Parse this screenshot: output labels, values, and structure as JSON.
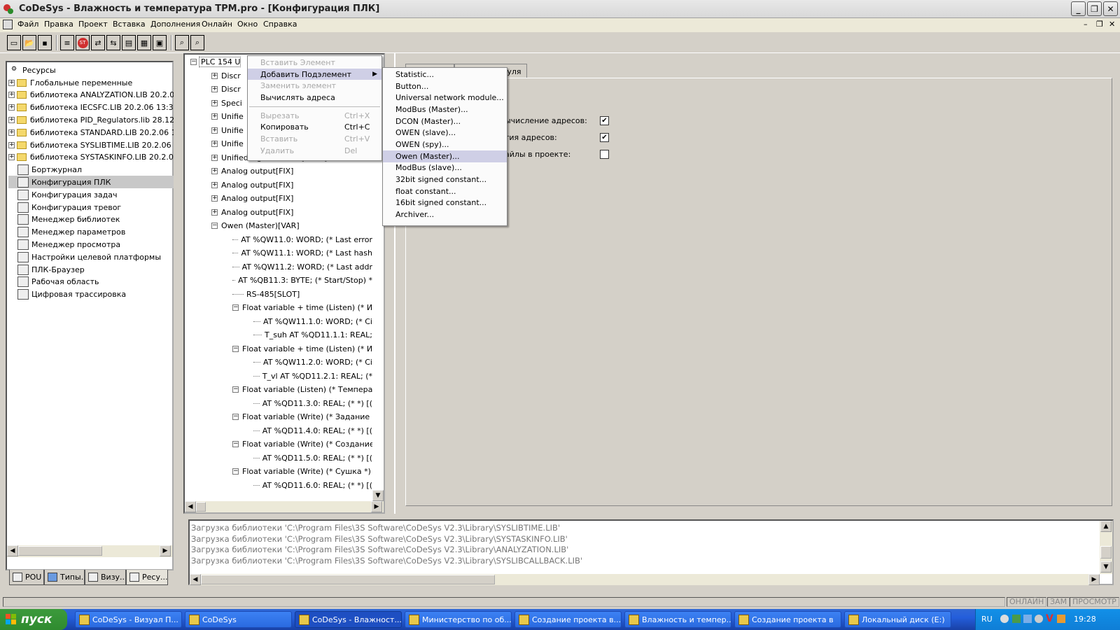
{
  "window": {
    "title": "CoDeSys - Влажность и температура ТРМ.pro - [Конфигурация ПЛК]",
    "app_icon": "codesys-app-icon",
    "controls": [
      "minimize",
      "restore",
      "close"
    ]
  },
  "menubar": {
    "items": [
      "Файл",
      "Правка",
      "Проект",
      "Вставка",
      "Дополнения",
      "Онлайн",
      "Окно",
      "Справка"
    ]
  },
  "toolbar": {
    "buttons": [
      "new-icon",
      "open-icon",
      "save-icon",
      "build-icon",
      "stop-icon",
      "login-icon",
      "logout-icon",
      "step-icon",
      "watch-icon",
      "print-icon",
      "find-icon",
      "replace-icon"
    ],
    "labels": {
      "stop": "ST"
    }
  },
  "resources": {
    "root": "Ресурсы",
    "items": [
      {
        "label": "Глобальные переменные",
        "type": "folder",
        "expandable": true
      },
      {
        "label": "библиотека ANALYZATION.LIB 20.2.06",
        "type": "folder",
        "expandable": true
      },
      {
        "label": "библиотека IECSFC.LIB 20.2.06 13:31:0",
        "type": "folder",
        "expandable": true
      },
      {
        "label": "библиотека PID_Regulators.lib 28.12.06",
        "type": "folder",
        "expandable": true
      },
      {
        "label": "библиотека STANDARD.LIB 20.2.06 13",
        "type": "folder",
        "expandable": true
      },
      {
        "label": "библиотека SYSLIBTIME.LIB 20.2.06 1",
        "type": "folder",
        "expandable": true
      },
      {
        "label": "библиотека SYSTASKINFO.LIB 20.2.06",
        "type": "folder",
        "expandable": true
      },
      {
        "label": "Бортжурнал",
        "type": "logbook-icon"
      },
      {
        "label": "Конфигурация ПЛК",
        "type": "plc-config-icon",
        "selected": true
      },
      {
        "label": "Конфигурация задач",
        "type": "task-config-icon"
      },
      {
        "label": "Конфигурация тревог",
        "type": "alarm-config-icon"
      },
      {
        "label": "Менеджер библиотек",
        "type": "library-manager-icon"
      },
      {
        "label": "Менеджер параметров",
        "type": "parameter-manager-icon"
      },
      {
        "label": "Менеджер просмотра",
        "type": "watch-manager-icon"
      },
      {
        "label": "Настройки целевой платформы",
        "type": "target-settings-icon"
      },
      {
        "label": "ПЛК-Браузер",
        "type": "plc-browser-icon"
      },
      {
        "label": "Рабочая область",
        "type": "workspace-icon"
      },
      {
        "label": "Цифровая трассировка",
        "type": "trace-icon"
      }
    ]
  },
  "left_tabs": [
    {
      "label": "POU",
      "icon": "pou-icon"
    },
    {
      "label": "Типы...",
      "icon": "types-icon"
    },
    {
      "label": "Визу...",
      "icon": "visualization-icon"
    },
    {
      "label": "Ресу...",
      "icon": "resources-icon"
    }
  ],
  "plc_tree": {
    "rows": [
      {
        "indent": 0,
        "toggle": "−",
        "text": "PLC 154 U"
      },
      {
        "indent": 1,
        "toggle": "+",
        "text": "Discr"
      },
      {
        "indent": 1,
        "toggle": "+",
        "text": "Discr"
      },
      {
        "indent": 1,
        "toggle": "+",
        "text": "Speci"
      },
      {
        "indent": 1,
        "toggle": "+",
        "text": "Unifie"
      },
      {
        "indent": 1,
        "toggle": "+",
        "text": "Unifie"
      },
      {
        "indent": 1,
        "toggle": "+",
        "text": "Unifie"
      },
      {
        "indent": 1,
        "toggle": "+",
        "text": "Unified signal sensor[SLOT]"
      },
      {
        "indent": 1,
        "toggle": "+",
        "text": "Analog output[FIX]"
      },
      {
        "indent": 1,
        "toggle": "+",
        "text": "Analog output[FIX]"
      },
      {
        "indent": 1,
        "toggle": "+",
        "text": "Analog output[FIX]"
      },
      {
        "indent": 1,
        "toggle": "+",
        "text": "Analog output[FIX]"
      },
      {
        "indent": 1,
        "toggle": "−",
        "text": "Owen (Master)[VAR]"
      },
      {
        "indent": 2,
        "toggle": "",
        "text": "AT %QW11.0: WORD; (* Last error"
      },
      {
        "indent": 2,
        "toggle": "",
        "text": "AT %QW11.1: WORD; (* Last hash"
      },
      {
        "indent": 2,
        "toggle": "",
        "text": "AT %QW11.2: WORD; (* Last addr"
      },
      {
        "indent": 2,
        "toggle": "",
        "text": "AT %QB11.3: BYTE; (* Start/Stop) *"
      },
      {
        "indent": 2,
        "toggle": "",
        "text": "RS-485[SLOT]"
      },
      {
        "indent": 2,
        "toggle": "−",
        "text": "Float variable + time (Listen) (* Изм"
      },
      {
        "indent": 3,
        "toggle": "",
        "text": "AT %QW11.1.0: WORD; (* Ci"
      },
      {
        "indent": 3,
        "toggle": "",
        "text": "T_suh AT %QD11.1.1: REAL;"
      },
      {
        "indent": 2,
        "toggle": "−",
        "text": "Float variable + time (Listen) (* Изм"
      },
      {
        "indent": 3,
        "toggle": "",
        "text": "AT %QW11.2.0: WORD; (* Ci"
      },
      {
        "indent": 3,
        "toggle": "",
        "text": "T_vl AT %QD11.2.1: REAL; (*"
      },
      {
        "indent": 2,
        "toggle": "−",
        "text": "Float variable (Listen) (* Температ"
      },
      {
        "indent": 3,
        "toggle": "",
        "text": "AT %QD11.3.0: REAL; (* *) [("
      },
      {
        "indent": 2,
        "toggle": "−",
        "text": "Float variable (Write) (* Задание ус"
      },
      {
        "indent": 3,
        "toggle": "",
        "text": "AT %QD11.4.0: REAL; (* *) [("
      },
      {
        "indent": 2,
        "toggle": "−",
        "text": "Float variable (Write) (* Создание в"
      },
      {
        "indent": 3,
        "toggle": "",
        "text": "AT %QD11.5.0: REAL; (* *) [("
      },
      {
        "indent": 2,
        "toggle": "−",
        "text": "Float variable (Write) (* Сушка *) [V"
      },
      {
        "indent": 3,
        "toggle": "",
        "text": "AT %QD11.6.0: REAL; (* *) [("
      }
    ]
  },
  "context_menu": {
    "items": [
      {
        "label": "Вставить Элемент",
        "disabled": true
      },
      {
        "label": "Добавить Подэлемент",
        "submenu": true,
        "highlight": true
      },
      {
        "label": "Заменить элемент",
        "disabled": true
      },
      {
        "label": "Вычислять адреса"
      },
      {
        "separator": true
      },
      {
        "label": "Вырезать",
        "shortcut": "Ctrl+X",
        "disabled": true
      },
      {
        "label": "Копировать",
        "shortcut": "Ctrl+C"
      },
      {
        "label": "Вставить",
        "shortcut": "Ctrl+V",
        "disabled": true
      },
      {
        "label": "Удалить",
        "shortcut": "Del",
        "disabled": true
      }
    ]
  },
  "submenu": {
    "items": [
      {
        "label": "Statistic..."
      },
      {
        "label": "Button..."
      },
      {
        "label": "Universal network module..."
      },
      {
        "label": "ModBus (Master)..."
      },
      {
        "label": "DCON (Master)..."
      },
      {
        "label": "OWEN (slave)..."
      },
      {
        "label": "OWEN (spy)..."
      },
      {
        "label": "Owen (Master)...",
        "highlight": true
      },
      {
        "label": "ModBus (slave)..."
      },
      {
        "label": "32bit signed constant..."
      },
      {
        "label": "float constant..."
      },
      {
        "label": "16bit signed constant..."
      },
      {
        "label": "Archiver..."
      }
    ]
  },
  "properties": {
    "tab_fragment": "одуля",
    "options": [
      {
        "label": "ычисление адресов:",
        "checked": true
      },
      {
        "label": "тия адресов:",
        "checked": true
      },
      {
        "label": "айлы в проекте:",
        "checked": false
      }
    ]
  },
  "messages": [
    "Загрузка библиотеки 'C:\\Program Files\\3S Software\\CoDeSys V2.3\\Library\\SYSLIBTIME.LIB'",
    "Загрузка библиотеки 'C:\\Program Files\\3S Software\\CoDeSys V2.3\\Library\\SYSTASKINFO.LIB'",
    "Загрузка библиотеки 'C:\\Program Files\\3S Software\\CoDeSys V2.3\\Library\\ANALYZATION.LIB'",
    "Загрузка библиотеки 'C:\\Program Files\\3S Software\\CoDeSys V2.3\\Library\\SYSLIBCALLBACK.LIB'"
  ],
  "statusbar": [
    "ОНЛАЙН",
    "ЗАМ",
    "ПРОСМОТР"
  ],
  "taskbar": {
    "start": "пуск",
    "tasks": [
      {
        "label": "CoDeSys - Визуал П...",
        "icon": "codesys-icon"
      },
      {
        "label": "CoDeSys",
        "icon": "codesys-icon"
      },
      {
        "label": "CoDeSys - Влажност...",
        "icon": "codesys-icon",
        "active": true
      },
      {
        "label": "Министерство по об...",
        "icon": "word-icon"
      },
      {
        "label": "Создание проекта в...",
        "icon": "word-icon"
      },
      {
        "label": "Влажность и темпер...",
        "icon": "folder-icon"
      },
      {
        "label": "Создание проекта в",
        "icon": "folder-icon"
      },
      {
        "label": "Локальный диск (E:)",
        "icon": "drive-icon"
      }
    ],
    "lang": "RU",
    "time": "19:28"
  }
}
